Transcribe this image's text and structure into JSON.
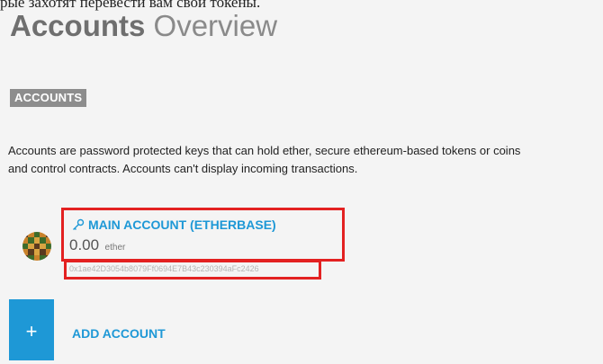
{
  "caption": "рые захотят перевести вам свои токены.",
  "header": {
    "title_strong": "Accounts",
    "title_light": "Overview"
  },
  "section": {
    "label": "ACCOUNTS",
    "description_line1": "Accounts are password protected keys that can hold ether, secure ethereum-based tokens or coins",
    "description_line2": "and control contracts. Accounts can't display incoming transactions."
  },
  "accounts": [
    {
      "name": "MAIN ACCOUNT (ETHERBASE)",
      "balance": "0.00",
      "unit": "ether",
      "address": "0x1ae42D3054b8079Ff0694E7B43c230394aFc2426"
    }
  ],
  "actions": {
    "add_symbol": "+",
    "add_label": "ADD ACCOUNT"
  },
  "icons": {
    "key": "key-icon",
    "avatar": "identicon-avatar"
  },
  "colors": {
    "accent": "#1e98d6",
    "highlight": "#e32121",
    "label_bg": "#8d8d8d"
  }
}
